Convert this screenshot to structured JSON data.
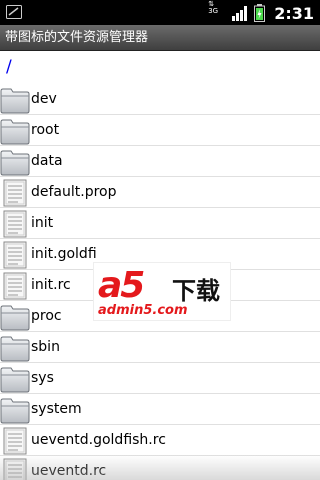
{
  "status_bar": {
    "notification_icon": "usb-icon",
    "network_type": "3G",
    "clock": "2:31"
  },
  "app_title": "带图标的文件资源管理器",
  "current_path": "/",
  "files": [
    {
      "name": "dev",
      "type": "folder",
      "icon": "folder-icon"
    },
    {
      "name": "root",
      "type": "folder",
      "icon": "folder-icon"
    },
    {
      "name": "data",
      "type": "folder",
      "icon": "folder-icon"
    },
    {
      "name": "default.prop",
      "type": "file",
      "icon": "file-icon"
    },
    {
      "name": "init",
      "type": "file",
      "icon": "file-icon"
    },
    {
      "name": "init.goldfi",
      "type": "file",
      "icon": "file-icon"
    },
    {
      "name": "init.rc",
      "type": "file",
      "icon": "file-icon"
    },
    {
      "name": "proc",
      "type": "folder",
      "icon": "folder-icon"
    },
    {
      "name": "sbin",
      "type": "folder",
      "icon": "folder-icon"
    },
    {
      "name": "sys",
      "type": "folder",
      "icon": "folder-icon"
    },
    {
      "name": "system",
      "type": "folder",
      "icon": "folder-icon"
    },
    {
      "name": "ueventd.goldfish.rc",
      "type": "file",
      "icon": "file-icon"
    },
    {
      "name": "ueventd.rc",
      "type": "file",
      "icon": "file-icon"
    }
  ],
  "watermark": {
    "brand": "a5",
    "download": "下载",
    "site": "admin5.com"
  },
  "colors": {
    "path_link": "#0000ee",
    "watermark_red": "#e4191c"
  }
}
